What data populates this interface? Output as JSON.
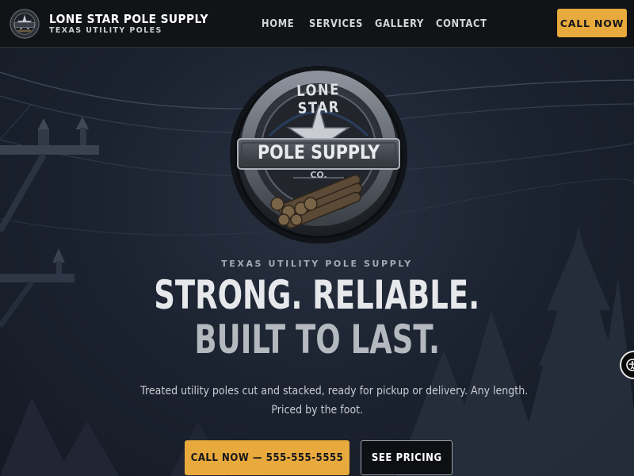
{
  "header": {
    "brand_name": "LONE STAR POLE SUPPLY",
    "brand_tagline": "TEXAS UTILITY POLES",
    "logo_icon": "star-badge-logo-icon",
    "nav": [
      {
        "label": "HOME"
      },
      {
        "label": "SERVICES"
      },
      {
        "label": "GALLERY"
      },
      {
        "label": "CONTACT"
      }
    ],
    "cta_label": "CALL NOW"
  },
  "hero": {
    "emblem": {
      "top_text": "LONE STAR",
      "main_text": "POLE SUPPLY",
      "sub_text": "CO.",
      "icon": "star-emblem-icon"
    },
    "eyebrow": "TEXAS UTILITY POLE SUPPLY",
    "headline_line1": "STRONG. RELIABLE.",
    "headline_line2": "BUILT TO LAST.",
    "subtext_line1": "Treated utility poles cut and stacked, ready for pickup or delivery. Any length.",
    "subtext_line2": "Priced by the foot.",
    "primary_cta": "CALL NOW — 555-555-5555",
    "secondary_cta": "SEE PRICING"
  },
  "accessibility_widget_icon": "accessibility-icon",
  "colors": {
    "accent": "#e8a93d",
    "header_bg": "#111317",
    "hero_bg": "#1c2331"
  }
}
